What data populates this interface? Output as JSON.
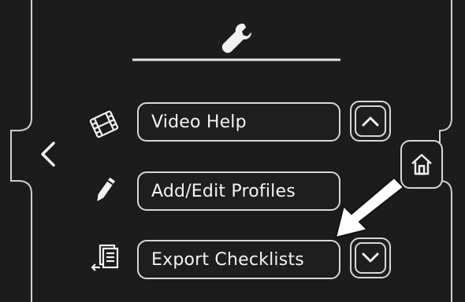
{
  "header": {
    "icon": "wrench-icon"
  },
  "navigation": {
    "back_icon": "chevron-left-icon",
    "home_icon": "home-icon"
  },
  "menu": {
    "items": [
      {
        "label": "Video Help",
        "icon": "film-icon"
      },
      {
        "label": "Add/Edit Profiles",
        "icon": "pencil-icon"
      },
      {
        "label": "Export Checklists",
        "icon": "export-icon"
      }
    ]
  },
  "scroll": {
    "up_icon": "chevron-up-icon",
    "down_icon": "chevron-down-icon"
  },
  "colors": {
    "background": "#1c1c1c",
    "foreground": "#f2f2f2",
    "outline": "#d8d8d8"
  }
}
